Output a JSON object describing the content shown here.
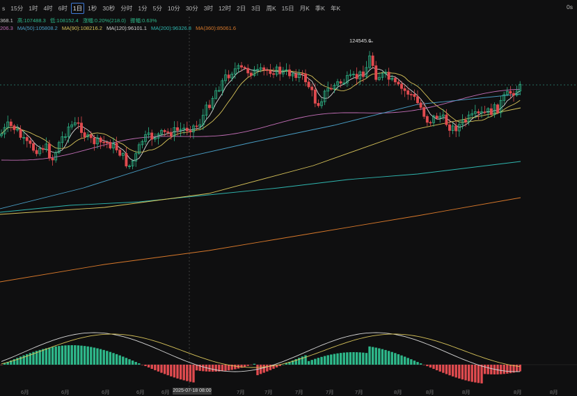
{
  "toolbar": {
    "partial_left": "s",
    "intervals": [
      "15分",
      "1时",
      "4时",
      "6时",
      "1日",
      "1秒",
      "30秒",
      "分时",
      "1分",
      "5分",
      "10分",
      "30分",
      "3时",
      "12时",
      "2日",
      "3日",
      "周K",
      "15日",
      "月K",
      "季K",
      "年K"
    ],
    "active_interval": "1日",
    "right_label": "0s",
    "icons": [
      "indicator-icon",
      "compare-icon",
      "layout-icon",
      "draw-icon",
      "alert-icon",
      "template-icon"
    ]
  },
  "indicators": {
    "line1": {
      "prefix": "368.1",
      "high": "高:107488.3",
      "low": "低:108152.4",
      "change": "涨幅:0.20%(218.0)",
      "amplitude": "振幅:0.63%"
    },
    "line2": {
      "ma_a": "206.3",
      "ma50": "MA(50):105808.2",
      "ma90": "MA(90):108216.2",
      "ma120": "MA(120):96101.1",
      "ma200": "MA(200):96326.8",
      "ma360": "MA(360):85061.6"
    }
  },
  "colors": {
    "up": "#2eb88a",
    "down": "#e04b4f",
    "ma_white": "#d8d8d8",
    "ma_yellow": "#d8c45a",
    "ma_pink": "#c46fb8",
    "ma_blue": "#4aa0c8",
    "ma_teal": "#2fb7b0",
    "ma_orange": "#d9792b",
    "dash": "#2f8f7a"
  },
  "price_callout": "124545.6",
  "axis": {
    "x_labels": [
      "6月",
      "6月",
      "6月",
      "6月",
      "6月",
      "7月",
      "7月",
      "7月",
      "7月",
      "7月",
      "8月",
      "8月",
      "8月",
      "8月",
      "8月"
    ],
    "crosshair_label": "2025-07-18 08:00"
  }
}
